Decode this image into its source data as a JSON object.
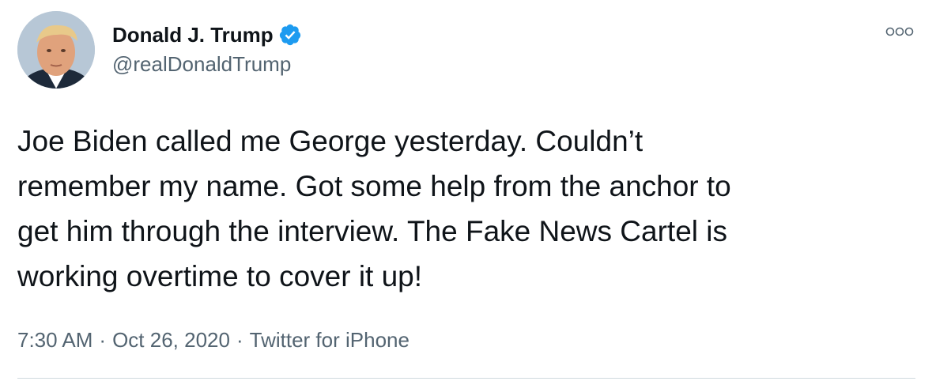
{
  "author": {
    "display_name": "Donald J. Trump",
    "handle": "@realDonaldTrump",
    "verified": true
  },
  "tweet": {
    "text": "Joe Biden called me George yesterday. Couldn’t\nremember my name. Got some help from the anchor to\nget him through the interview. The Fake News Cartel is\nworking overtime to cover it up!",
    "time": "7:30 AM",
    "date": "Oct 26, 2020",
    "source": "Twitter for iPhone",
    "separator": "·"
  },
  "icons": {
    "verified": "verified-badge-icon",
    "more": "more-options-icon"
  },
  "colors": {
    "accent": "#1d9bf0",
    "text_primary": "#0f1419",
    "text_secondary": "#536471",
    "divider": "#cfd9de"
  }
}
